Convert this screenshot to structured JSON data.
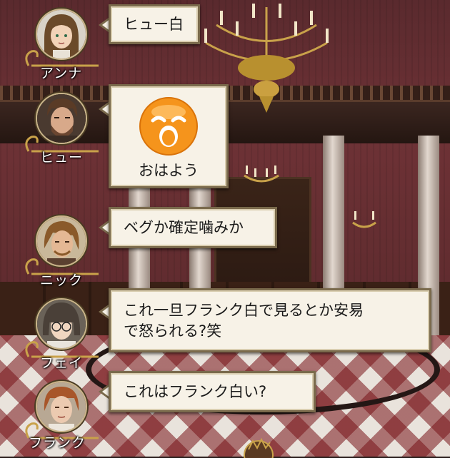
{
  "messages": [
    {
      "speaker": "アンナ",
      "text": "ヒュー白"
    },
    {
      "speaker": "ヒュー",
      "sticker_icon": "surprised-face-icon",
      "text": "おはよう"
    },
    {
      "speaker": "ニック",
      "text": "ベグか確定噛みか"
    },
    {
      "speaker": "フェイ",
      "text_line1": "これ一旦フランク白で見るとか安易",
      "text_line2": "で怒られる?笑"
    },
    {
      "speaker": "フランク",
      "text": "これはフランク白い?"
    }
  ],
  "colors": {
    "bubble_fill": "#f7f2e7",
    "bubble_border": "#7a6a4c",
    "sticker_orange": "#f5941c",
    "wall_red": "#6e3236"
  }
}
